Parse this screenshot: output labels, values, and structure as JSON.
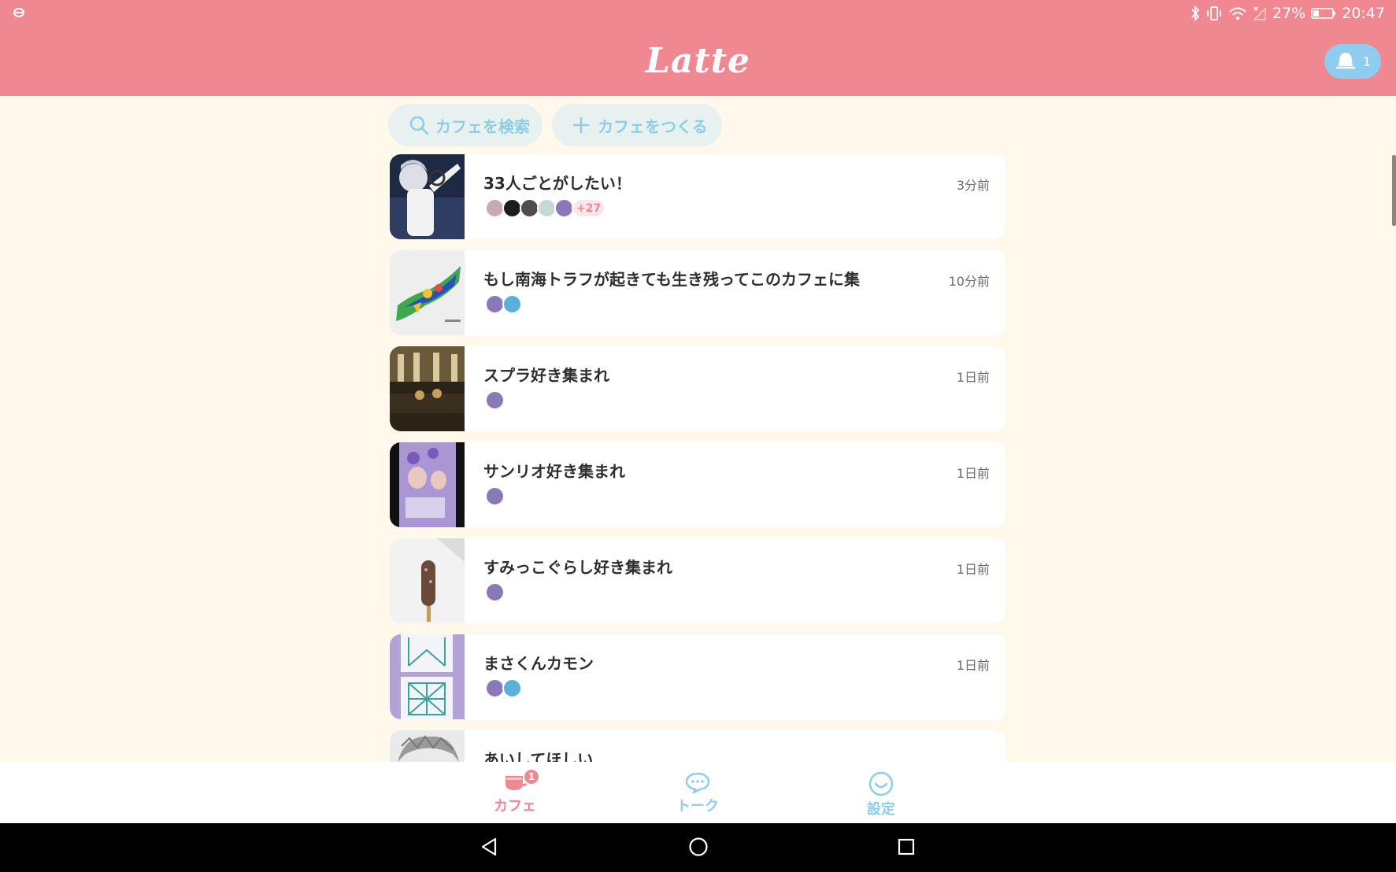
{
  "status_bar": {
    "battery": "27%",
    "time": "20:47"
  },
  "header": {
    "logo": "Latte",
    "notification_count": "1"
  },
  "actions": {
    "search_label": "カフェを検索",
    "create_label": "カフェをつくる"
  },
  "cafes": [
    {
      "title": "33人ごとがしたい！",
      "time": "3分前",
      "more_members": "+27"
    },
    {
      "title": "もし南海トラフが起きても生き残ってこのカフェに集",
      "time": "10分前"
    },
    {
      "title": "スプラ好き集まれ",
      "time": "1日前"
    },
    {
      "title": "サンリオ好き集まれ",
      "time": "1日前"
    },
    {
      "title": "すみっこぐらし好き集まれ",
      "time": "1日前"
    },
    {
      "title": "まさくんカモン",
      "time": "1日前"
    },
    {
      "title": "あいしてほしい"
    }
  ],
  "bottom_nav": {
    "cafe_label": "カフェ",
    "cafe_badge": "1",
    "talk_label": "トーク",
    "settings_label": "設定"
  },
  "colors": {
    "header": "#f08892",
    "background": "#fef9ea",
    "accent_blue": "#8ecde8"
  }
}
